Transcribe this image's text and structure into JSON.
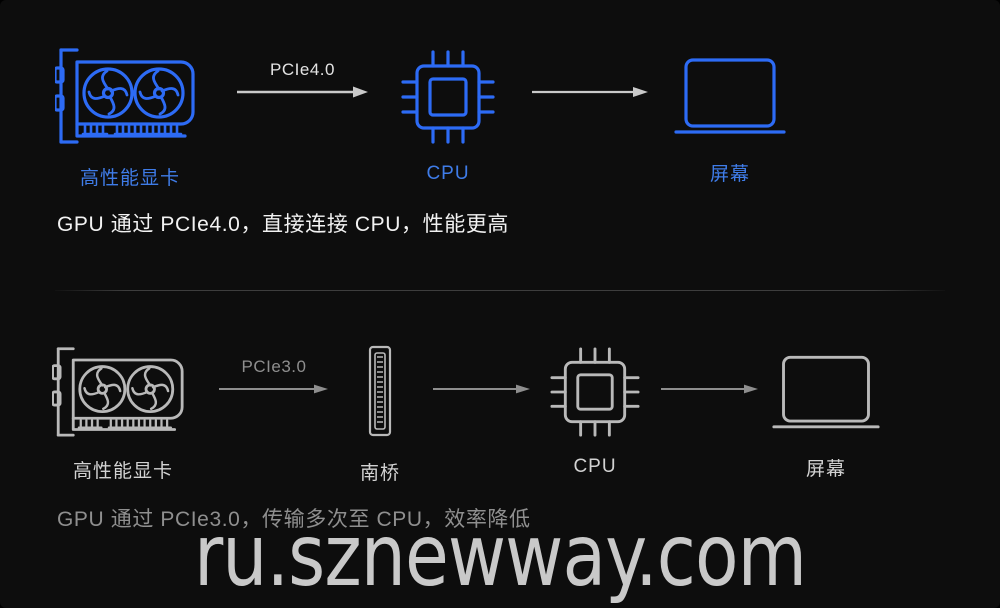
{
  "canvas": {
    "background": "#0d0d0d",
    "accent_color": "#2d6bf5",
    "accent_label_color": "#3f7ce8",
    "muted_color": "#b9b9b9",
    "dim_color": "#8e8e8e"
  },
  "rows": [
    {
      "id": "pcie4-row",
      "style": "accent",
      "nodes": [
        {
          "icon": "graphics-card-icon",
          "label": "高性能显卡"
        },
        {
          "icon": "cpu-chip-icon",
          "label": "CPU"
        },
        {
          "icon": "monitor-screen-icon",
          "label": "屏幕"
        }
      ],
      "connectors": [
        {
          "label": "PCIe4.0",
          "icon": "arrow-right-icon"
        },
        {
          "label": "",
          "icon": "arrow-right-icon"
        }
      ],
      "caption": "GPU 通过 PCIe4.0，直接连接 CPU，性能更高"
    },
    {
      "id": "pcie3-row",
      "style": "muted",
      "nodes": [
        {
          "icon": "graphics-card-icon",
          "label": "高性能显卡"
        },
        {
          "icon": "southbridge-slot-icon",
          "label": "南桥"
        },
        {
          "icon": "cpu-chip-icon",
          "label": "CPU"
        },
        {
          "icon": "monitor-screen-icon",
          "label": "屏幕"
        }
      ],
      "connectors": [
        {
          "label": "PCIe3.0",
          "icon": "arrow-right-icon"
        },
        {
          "label": "",
          "icon": "arrow-right-icon"
        },
        {
          "label": "",
          "icon": "arrow-right-icon"
        }
      ],
      "caption": "GPU 通过 PCIe3.0，传输多次至 CPU，效率降低"
    }
  ],
  "watermark": {
    "text": "ru.sznewway.com"
  }
}
